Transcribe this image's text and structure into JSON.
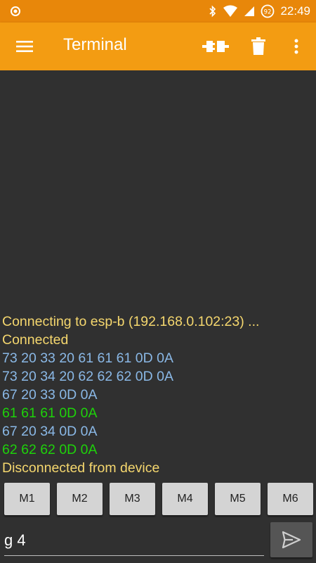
{
  "status_bar": {
    "time": "22:49",
    "battery_level": "92",
    "icons": [
      "target-icon",
      "bluetooth-icon",
      "wifi-icon",
      "signal-icon",
      "battery-icon"
    ]
  },
  "app_bar": {
    "title": "Terminal",
    "actions": [
      "connect-icon",
      "trash-icon",
      "more-vert-icon"
    ]
  },
  "colors": {
    "status_bar": "#e8870a",
    "app_bar": "#f39c12",
    "background": "#303030",
    "status_text": "#f5d76e",
    "sent_text": "#8ab8e6",
    "received_text": "#1ed20a"
  },
  "terminal": {
    "lines": [
      {
        "text": "Connecting to esp-b (192.168.0.102:23) ...",
        "kind": "status"
      },
      {
        "text": "Connected",
        "kind": "status"
      },
      {
        "text": "73 20 33 20 61 61 61 0D 0A",
        "kind": "sent"
      },
      {
        "text": "73 20 34 20 62 62 62 0D 0A",
        "kind": "sent"
      },
      {
        "text": "67 20 33 0D 0A",
        "kind": "sent"
      },
      {
        "text": "61 61 61 0D 0A",
        "kind": "received"
      },
      {
        "text": "67 20 34 0D 0A",
        "kind": "sent"
      },
      {
        "text": "62 62 62 0D 0A",
        "kind": "received"
      },
      {
        "text": "Disconnected from device",
        "kind": "status"
      }
    ]
  },
  "macros": [
    "M1",
    "M2",
    "M3",
    "M4",
    "M5",
    "M6"
  ],
  "input": {
    "value": "g 4",
    "placeholder": ""
  }
}
